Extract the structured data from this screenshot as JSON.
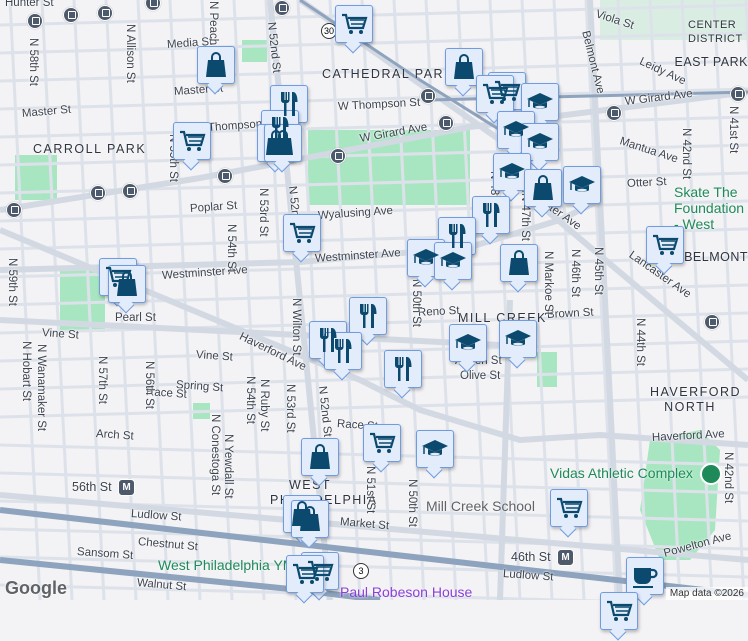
{
  "map": {
    "neighborhoods": [
      "CARROLL PARK",
      "CATHEDRAL PARK",
      "MILL CREEK",
      "WEST PHILADELPHIA",
      "HAVERFORD NORTH",
      "BELMONT",
      "EAST PARK",
      "CENTER DISTRICT"
    ],
    "streets": {
      "hunter": "Hunter St",
      "media": "Media St",
      "master1": "Master St",
      "master2": "Master St",
      "thompson1": "W Thompson St",
      "thompson2": "Thompson St",
      "girard1": "W Girard Ave",
      "girard2": "W Girard Ave",
      "poplar": "Poplar St",
      "wyalusing": "Wyalusing Ave",
      "westminster1": "Westminster Ave",
      "westminster2": "Westminster Ave",
      "lancaster1": "Lancaster Ave",
      "lancaster2": "Lancaster Ave",
      "pearl": "Pearl St",
      "vine1": "Vine St",
      "vine2": "Vine St",
      "haverford1": "Haverford Ave",
      "haverford2": "Haverford Ave",
      "reno": "Reno St",
      "brown": "Brown St",
      "aspen": "Aspen St",
      "olive": "Olive St",
      "spring": "Spring St",
      "race1": "Race St",
      "race2": "Race St",
      "arch": "Arch St",
      "market": "Market St",
      "ludlow1": "Ludlow St",
      "ludlow2": "Ludlow St",
      "chestnut": "Chestnut St",
      "sansom": "Sansom St",
      "walnut": "Walnut St",
      "powelton": "Powelton Ave",
      "mantua": "Mantua Ave",
      "otter": "Otter St",
      "viola": "Viola St",
      "leidy": "Leidy Ave",
      "belmont": "Belmont Ave",
      "n58": "N 58th St",
      "n59": "N 59th St",
      "allison": "N Allison St",
      "peach": "N Peach St",
      "n52a": "N 52nd St",
      "n52b": "N 52nd St",
      "n52c": "N 52nd St",
      "n55": "N 55th St",
      "n53a": "N 53rd St",
      "n54a": "N 54th St",
      "wilton": "N Wilton St",
      "n50a": "N 50th St",
      "n50b": "N 50th St",
      "n48": "N 48th St",
      "n47": "N 47th St",
      "markoe": "N Markoe St",
      "n46": "N 46th St",
      "n45": "N 45th St",
      "n44": "N 44th St",
      "n42a": "N 42nd St",
      "n42b": "N 42nd St",
      "n41": "N 41st St",
      "hobart": "N Hobart St",
      "wanamaker": "N Wanamaker St",
      "n57": "N 57th St",
      "n56": "N 56th St",
      "conestoga": "N Conestoga St",
      "yewdall": "N Yewdall St",
      "n54b": "N 54th St",
      "ruby": "N Ruby St",
      "n53b": "N 53rd St",
      "n51": "N 51st St"
    },
    "stations": {
      "s56": "56th St",
      "s46": "46th St",
      "metro_glyph": "M"
    },
    "route_shields": [
      "30",
      "3"
    ],
    "pois": {
      "skate": "Skate The Foundation - West",
      "vidas": "Vidas Athletic Complex",
      "mill_creek_school": "Mill Creek School",
      "ymca": "West Philadelphia YMCA",
      "robeson": "Paul Robeson House"
    },
    "google_logo": "Google",
    "attribution": "Map data ©2026"
  },
  "colors": {
    "marker_fill": "#e3ecfb",
    "marker_border": "#6f9be0",
    "icon": "#0b4a6e",
    "park": "#a8e6c1"
  }
}
